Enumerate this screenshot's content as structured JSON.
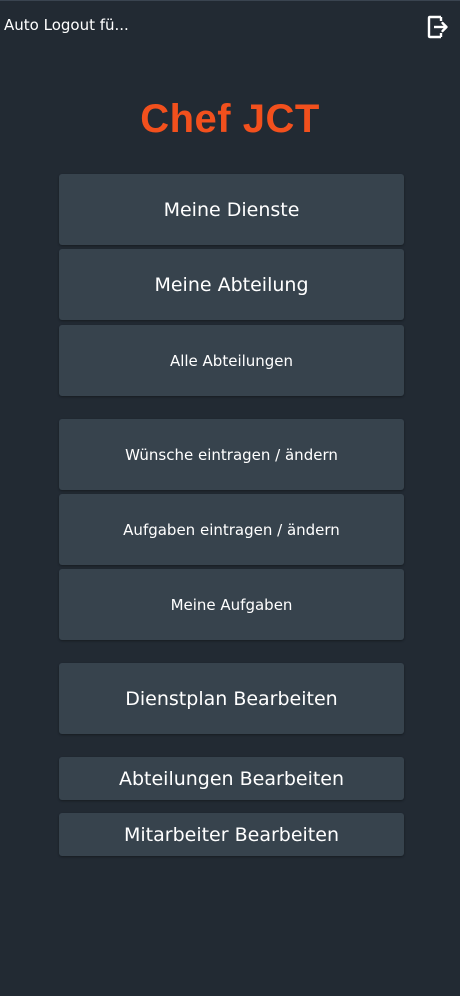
{
  "status_bar": {
    "auto_logout_text": "Auto Logout fü...",
    "logout_icon": "logout-icon"
  },
  "app": {
    "title": "Chef JCT",
    "title_color": "#f2501d",
    "background_color": "#222a33",
    "button_color": "#37434d"
  },
  "menu": {
    "meine_dienste": "Meine Dienste",
    "meine_abteilung": "Meine Abteilung",
    "alle_abteilungen": "Alle Abteilungen",
    "wuensche": "Wünsche eintragen / ändern",
    "aufgaben_eintragen": "Aufgaben eintragen / ändern",
    "meine_aufgaben": "Meine Aufgaben",
    "dienstplan_bearbeiten": "Dienstplan Bearbeiten",
    "abteilungen_bearbeiten": "Abteilungen Bearbeiten",
    "mitarbeiter_bearbeiten": "Mitarbeiter Bearbeiten"
  }
}
